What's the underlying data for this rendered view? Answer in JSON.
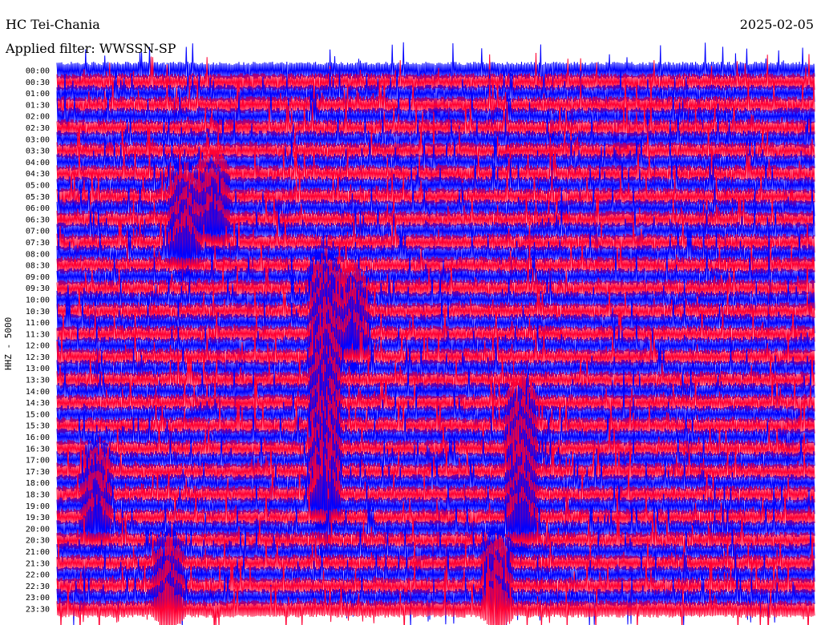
{
  "header": {
    "station": "HC Tei-Chania",
    "filter": "Applied filter: WWSSN-SP",
    "date": "2025-02-05"
  },
  "chart_data": {
    "type": "line",
    "title": "HC Tei-Chania",
    "ylabel": "HHZ - 5000",
    "row_labels": [
      "00:00",
      "00:30",
      "01:00",
      "01:30",
      "02:00",
      "02:30",
      "03:00",
      "03:30",
      "04:00",
      "04:30",
      "05:00",
      "05:30",
      "06:00",
      "06:30",
      "07:00",
      "07:30",
      "08:00",
      "08:30",
      "09:00",
      "09:30",
      "10:00",
      "10:30",
      "11:00",
      "11:30",
      "12:00",
      "12:30",
      "13:00",
      "13:30",
      "14:00",
      "14:30",
      "15:00",
      "15:30",
      "16:00",
      "16:30",
      "17:00",
      "17:30",
      "18:00",
      "18:30",
      "19:00",
      "19:30",
      "20:00",
      "20:30",
      "21:00",
      "21:30",
      "22:00",
      "22:30",
      "23:00",
      "23:30"
    ],
    "trace_colors": [
      "#0000ff",
      "#ff0033"
    ],
    "grid": false
  }
}
